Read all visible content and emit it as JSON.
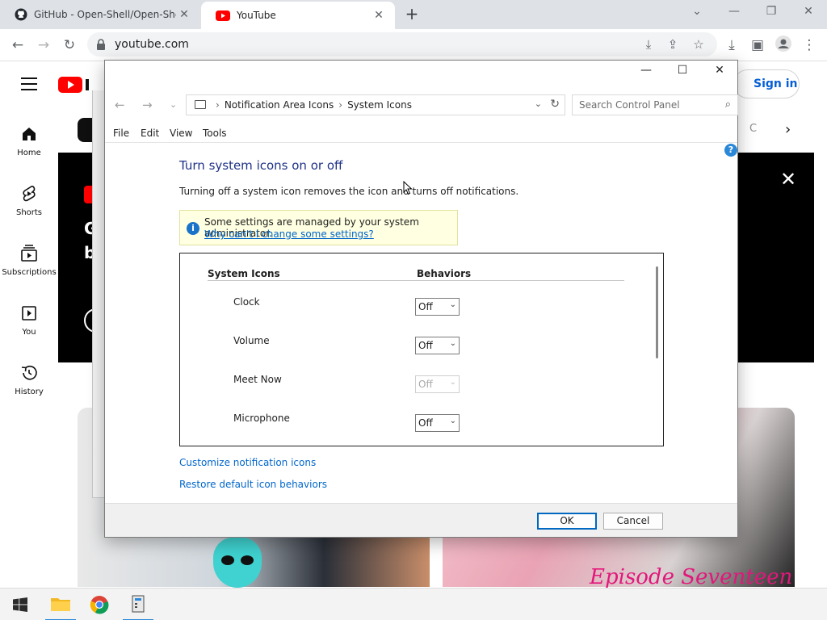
{
  "browser": {
    "tabs": [
      {
        "title": "GitHub - Open-Shell/Open-Shell",
        "icon": "github-icon",
        "active": false
      },
      {
        "title": "YouTube",
        "icon": "youtube-icon",
        "active": true
      }
    ],
    "url": "youtube.com"
  },
  "youtube": {
    "sign_in": "Sign in",
    "nav": [
      {
        "label": "Home",
        "icon": "home-icon"
      },
      {
        "label": "Shorts",
        "icon": "shorts-icon"
      },
      {
        "label": "Subscriptions",
        "icon": "subscriptions-icon"
      },
      {
        "label": "You",
        "icon": "you-icon"
      },
      {
        "label": "History",
        "icon": "history-icon"
      }
    ],
    "chip_partial": "C",
    "banner_text_line1": "G",
    "banner_text_line2": "b",
    "thumb_caption": "Episode Seventeen"
  },
  "control_panel": {
    "breadcrumb": [
      "Notification Area Icons",
      "System Icons"
    ],
    "search_placeholder": "Search Control Panel",
    "menu": [
      "File",
      "Edit",
      "View",
      "Tools"
    ],
    "heading": "Turn system icons on or off",
    "description": "Turning off a system icon removes the icon and turns off notifications.",
    "info_message": "Some settings are managed by your system administrator.",
    "info_link": "Why can't I change some settings?",
    "table": {
      "col_icons": "System Icons",
      "col_behaviors": "Behaviors",
      "rows": [
        {
          "name": "Clock",
          "value": "Off",
          "enabled": true
        },
        {
          "name": "Volume",
          "value": "Off",
          "enabled": true
        },
        {
          "name": "Meet Now",
          "value": "Off",
          "enabled": false
        },
        {
          "name": "Microphone",
          "value": "Off",
          "enabled": true
        }
      ]
    },
    "links": [
      "Customize notification icons",
      "Restore default icon behaviors"
    ],
    "buttons": {
      "ok": "OK",
      "cancel": "Cancel"
    }
  },
  "colors": {
    "accent": "#0067c0",
    "link": "#0066cc",
    "heading": "#1e3287",
    "info_bg": "#ffffe1",
    "yt_red": "#ff0000"
  }
}
